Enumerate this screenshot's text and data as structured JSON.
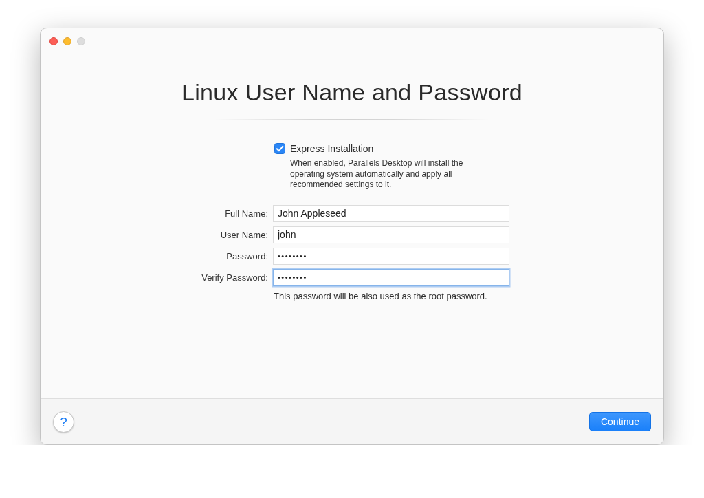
{
  "window": {
    "controls": [
      {
        "kind": "close",
        "disabled": false
      },
      {
        "kind": "minimize",
        "disabled": false
      },
      {
        "kind": "zoom",
        "disabled": true
      }
    ]
  },
  "title": "Linux User Name and Password",
  "express_installation": {
    "label": "Express Installation",
    "checked": true,
    "description": "When enabled, Parallels Desktop will install the operating system automatically and apply all recommended settings to it."
  },
  "fields": [
    {
      "kind": "text",
      "label": "Full Name:",
      "value": "John Appleseed",
      "focused": false
    },
    {
      "kind": "text",
      "label": "User Name:",
      "value": "john",
      "focused": false
    },
    {
      "kind": "password",
      "label": "Password:",
      "value": "••••••••",
      "focused": false
    },
    {
      "kind": "password",
      "label": "Verify Password:",
      "value": "••••••••",
      "focused": true
    }
  ],
  "hint": "This password will be also used as the root password.",
  "footer": {
    "help_button": "?",
    "continue_button": "Continue"
  }
}
